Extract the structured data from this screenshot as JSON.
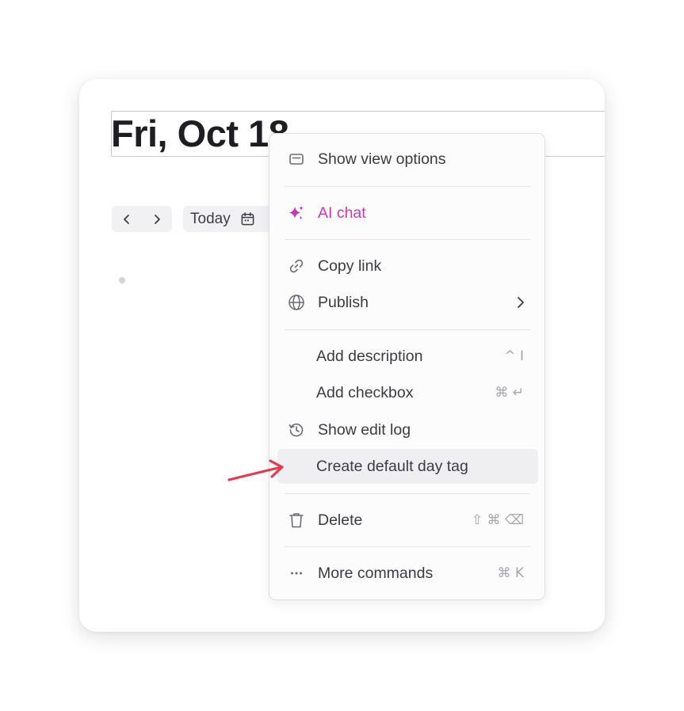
{
  "page": {
    "title": "Fri, Oct 18",
    "today_label": "Today",
    "accent_ai": "#c23bb6",
    "arrow_color": "#e8384f"
  },
  "nav": {
    "prev_icon": "chevron-left-icon",
    "next_icon": "chevron-right-icon",
    "calendar_icon": "calendar-icon"
  },
  "menu": {
    "items": [
      {
        "label": "Show view options",
        "icon": "panel-icon"
      },
      {
        "label": "AI chat",
        "icon": "sparkles-icon"
      },
      {
        "label": "Copy link",
        "icon": "link-icon"
      },
      {
        "label": "Publish",
        "icon": "globe-icon",
        "submenu": true
      },
      {
        "label": "Add description",
        "shortcut": "^ I"
      },
      {
        "label": "Add checkbox",
        "shortcut": "⌘ ↵"
      },
      {
        "label": "Show edit log",
        "icon": "history-icon"
      },
      {
        "label": "Create default day tag",
        "highlighted": true
      },
      {
        "label": "Delete",
        "icon": "trash-icon",
        "shortcut": "⇧ ⌘ ⌫"
      },
      {
        "label": "More commands",
        "icon": "ellipsis-icon",
        "shortcut": "⌘ K"
      }
    ]
  }
}
